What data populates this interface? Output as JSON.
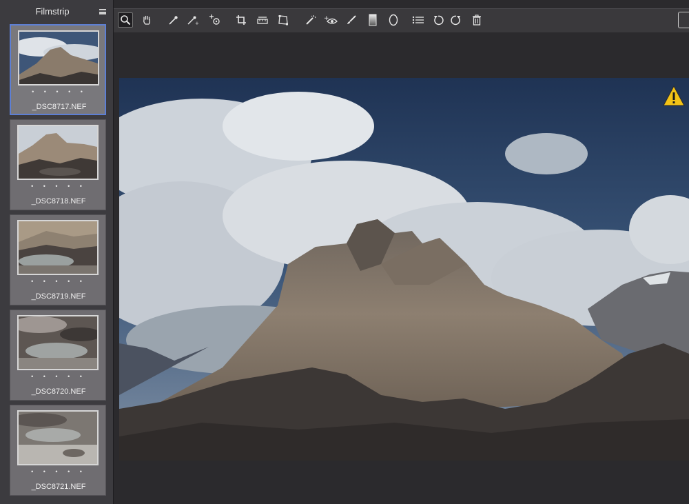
{
  "filmstrip": {
    "title": "Filmstrip",
    "rating_dots": "• • • • •",
    "items": [
      {
        "name": "_DSC8717.NEF",
        "selected": true
      },
      {
        "name": "_DSC8718.NEF",
        "selected": false
      },
      {
        "name": "_DSC8719.NEF",
        "selected": false
      },
      {
        "name": "_DSC8720.NEF",
        "selected": false
      },
      {
        "name": "_DSC8721.NEF",
        "selected": false
      }
    ]
  },
  "toolbar": {
    "tools": [
      {
        "id": "zoom",
        "icon": "zoom-icon",
        "active": true
      },
      {
        "id": "hand",
        "icon": "hand-icon"
      },
      {
        "id": "white-balance",
        "icon": "white-balance-eyedropper-icon"
      },
      {
        "id": "color-sampler",
        "icon": "color-sampler-icon"
      },
      {
        "id": "targeted-adjustment",
        "icon": "targeted-adjustment-icon"
      },
      {
        "id": "crop",
        "icon": "crop-icon"
      },
      {
        "id": "straighten",
        "icon": "straighten-icon"
      },
      {
        "id": "transform",
        "icon": "transform-icon"
      },
      {
        "id": "spot-removal",
        "icon": "spot-removal-icon"
      },
      {
        "id": "red-eye",
        "icon": "red-eye-icon"
      },
      {
        "id": "adjustment-brush",
        "icon": "adjustment-brush-icon"
      },
      {
        "id": "graduated-filter",
        "icon": "graduated-filter-icon"
      },
      {
        "id": "radial-filter",
        "icon": "radial-filter-icon"
      },
      {
        "id": "preferences",
        "icon": "list-icon"
      },
      {
        "id": "rotate-left",
        "icon": "rotate-left-icon"
      },
      {
        "id": "rotate-right",
        "icon": "rotate-right-icon"
      },
      {
        "id": "delete",
        "icon": "trash-icon"
      }
    ]
  },
  "preview": {
    "warning_icon": "warning-icon",
    "warning_color": "#f3c316"
  }
}
